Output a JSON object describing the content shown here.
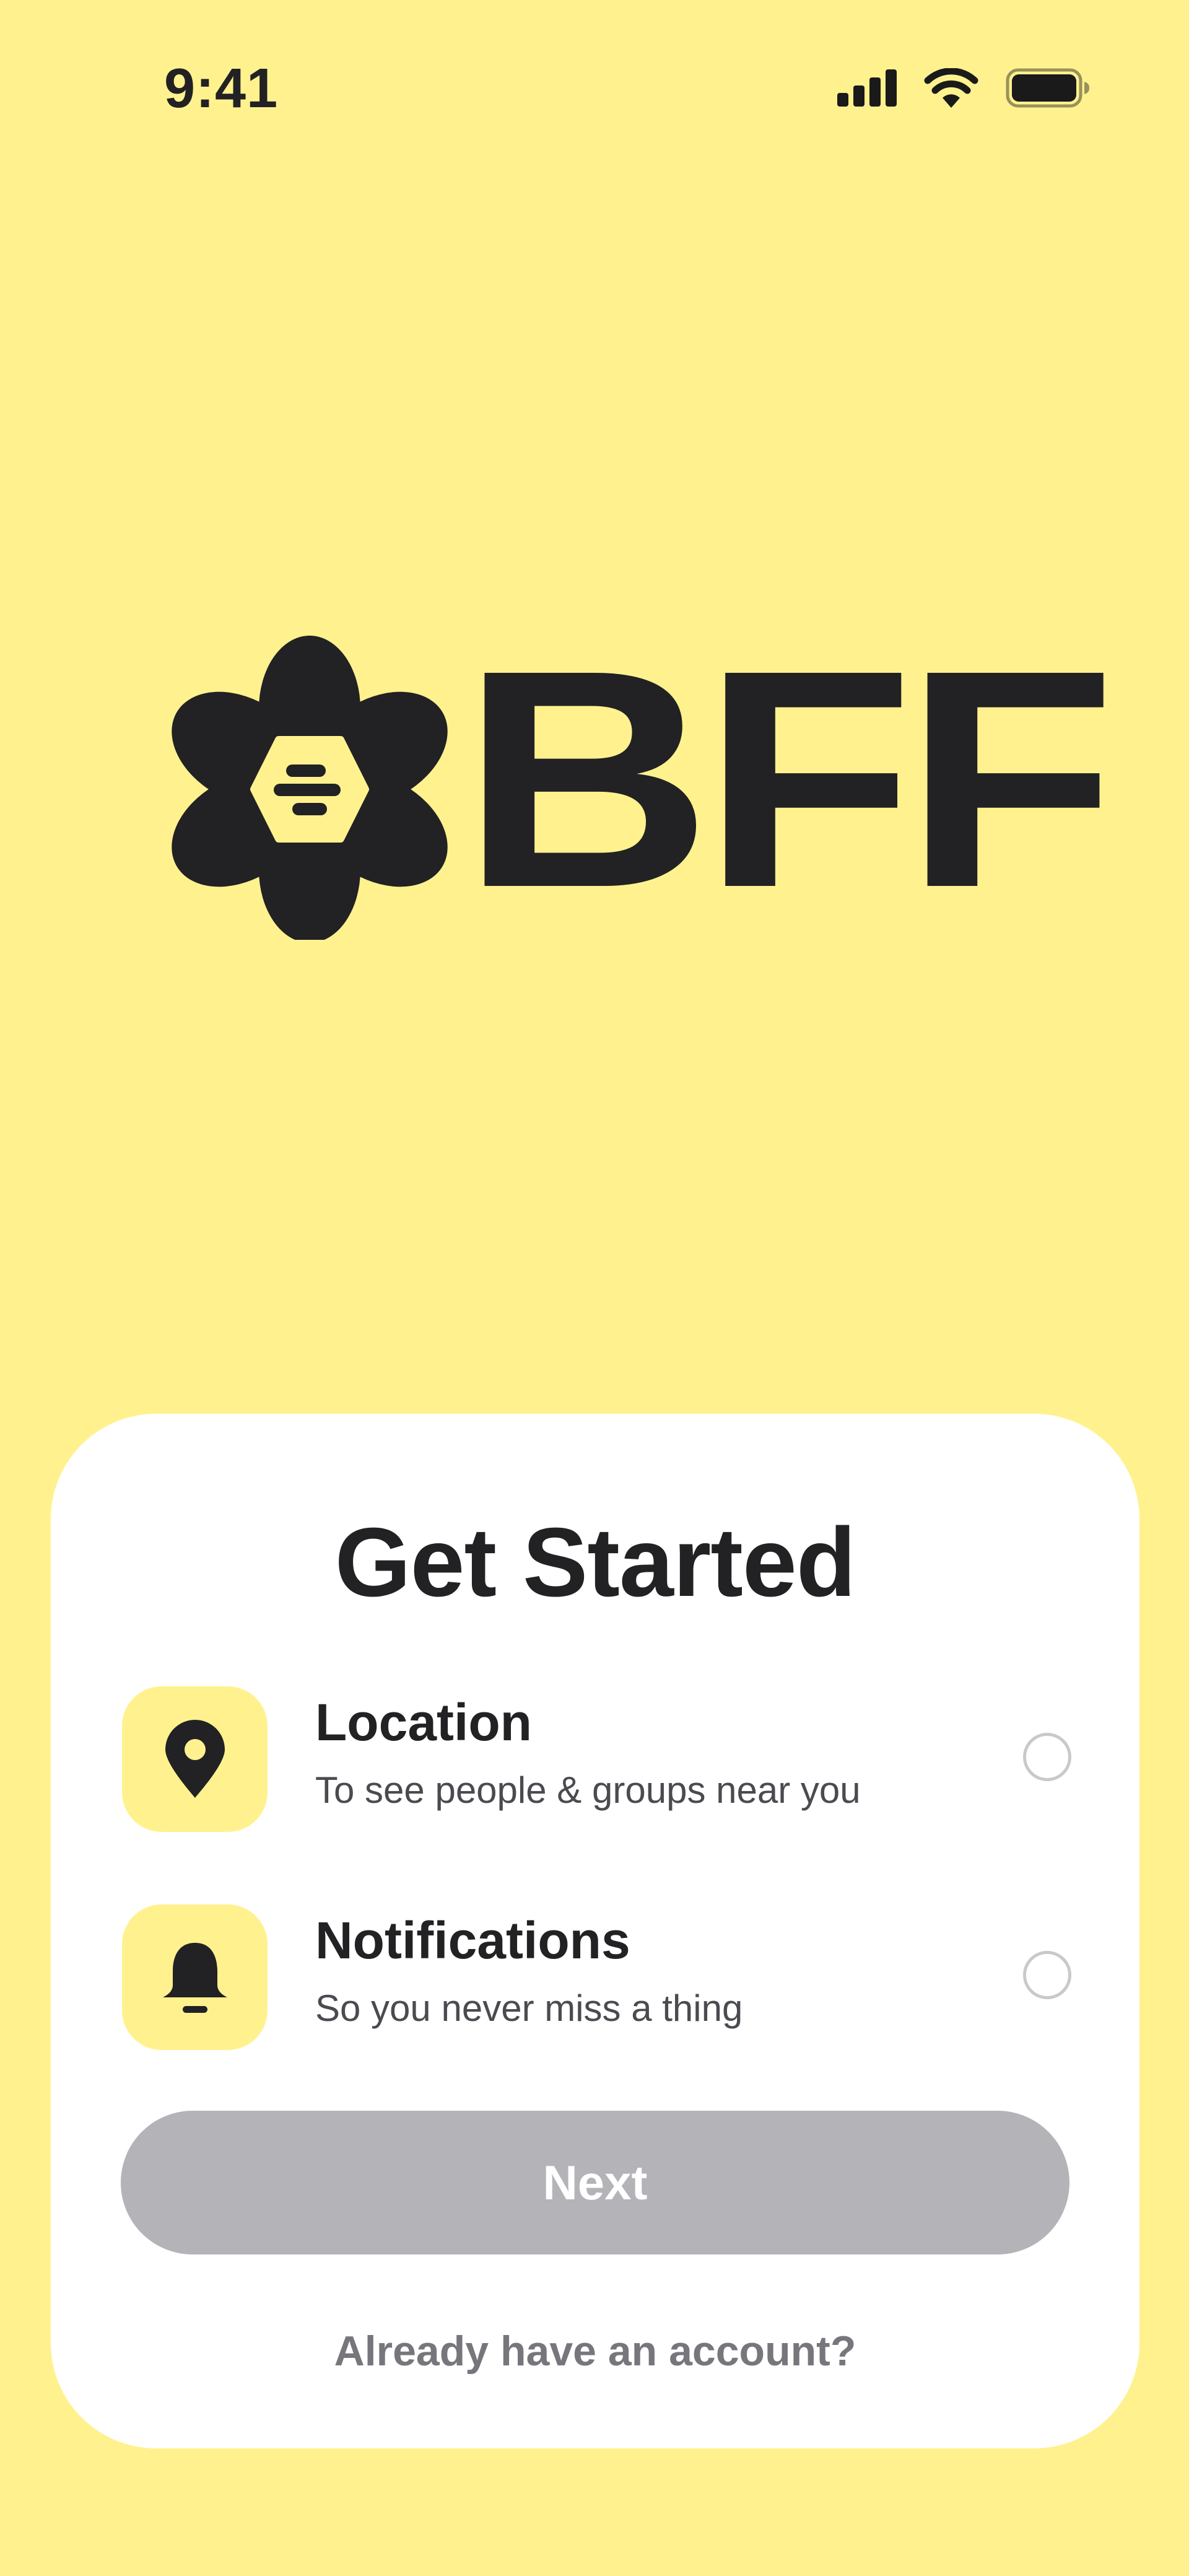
{
  "status_bar": {
    "time": "9:41",
    "signal_icon": "cellular-signal-icon",
    "wifi_icon": "wifi-icon",
    "battery_icon": "battery-icon"
  },
  "logo": {
    "icon": "bee-flower-logo-icon",
    "wordmark": "BFF"
  },
  "card": {
    "title": "Get Started",
    "permissions": [
      {
        "icon": "location-pin-icon",
        "title": "Location",
        "description": "To see people & groups near you",
        "checked": false
      },
      {
        "icon": "bell-icon",
        "title": "Notifications",
        "description": "So you never miss a thing",
        "checked": false
      }
    ],
    "next_label": "Next",
    "login_link": "Already have an account?"
  },
  "colors": {
    "background": "#FFF28E",
    "card": "#FFFFFF",
    "ink": "#222124",
    "button_disabled": "#B4B3B8",
    "muted_text": "#77767C"
  }
}
